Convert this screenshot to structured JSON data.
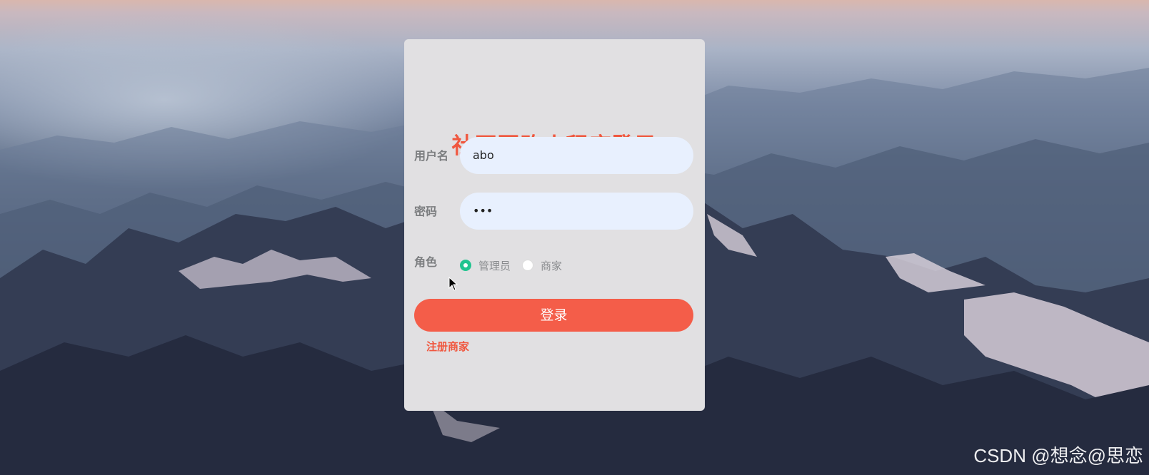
{
  "login": {
    "title": "社区团购小程序登录",
    "username_label": "用户名",
    "username_value": "abo",
    "password_label": "密码",
    "password_masked": "•••",
    "role_label": "角色",
    "roles": [
      {
        "label": "管理员",
        "checked": true
      },
      {
        "label": "商家",
        "checked": false
      }
    ],
    "login_button": "登录",
    "register_link": "注册商家"
  },
  "watermark": "CSDN @想念@思恋",
  "colors": {
    "accent": "#f0573f",
    "button": "#f45d49",
    "radio_checked": "#21c48f",
    "input_bg": "#e8f0fe",
    "panel_bg": "#e1e0e2"
  }
}
